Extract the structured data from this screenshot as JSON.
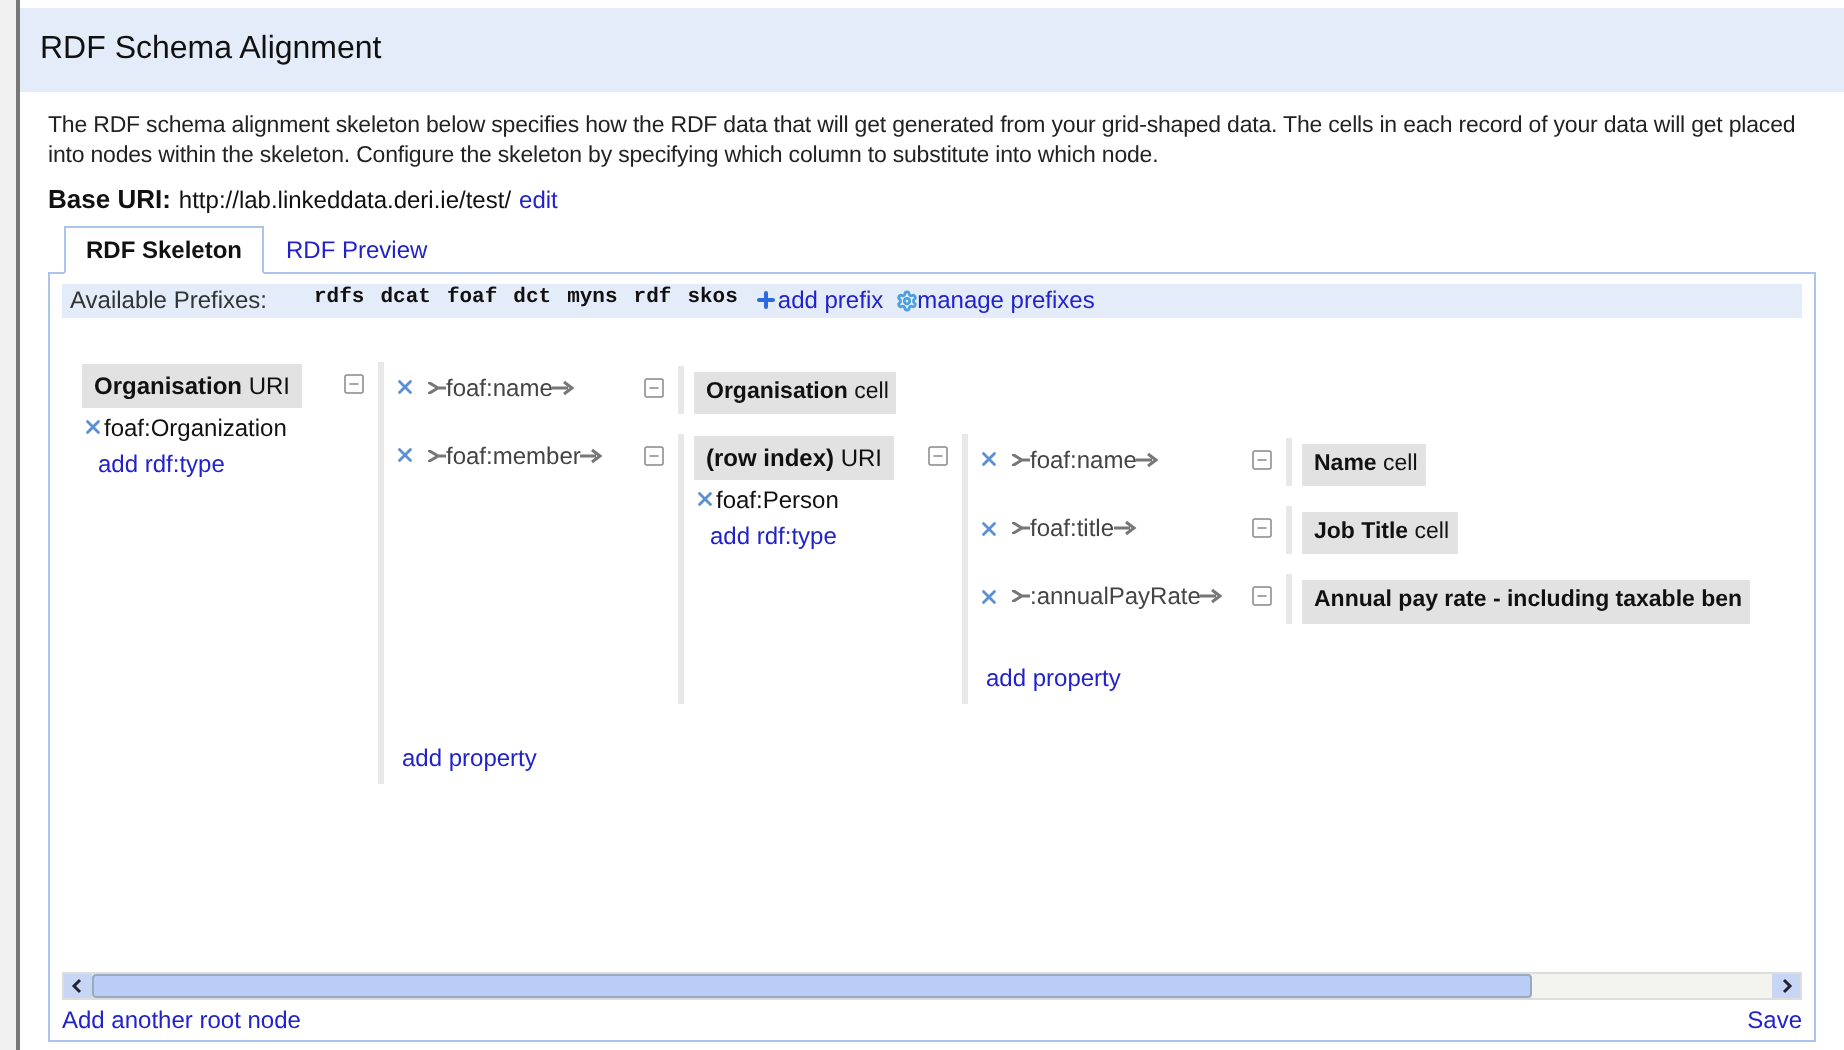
{
  "window": {
    "title": "RDF Schema Alignment"
  },
  "intro": "The RDF schema alignment skeleton below specifies how the RDF data that will get generated from your grid-shaped data. The cells in each record of your data will get placed into nodes within the skeleton. Configure the skeleton by specifying which column to substitute into which node.",
  "base_uri": {
    "label": "Base URI:",
    "value": "http://lab.linkeddata.deri.ie/test/",
    "edit": "edit"
  },
  "tabs": [
    {
      "label": "RDF Skeleton",
      "selected": true
    },
    {
      "label": "RDF Preview",
      "selected": false
    }
  ],
  "prefixes": {
    "label": "Available Prefixes:",
    "items": [
      "rdfs",
      "dcat",
      "foaf",
      "dct",
      "myns",
      "rdf",
      "skos"
    ],
    "add": "add prefix",
    "manage": "manage prefixes"
  },
  "skeleton": {
    "label": "**Organisation** URI",
    "kind": "uri",
    "types": [
      "foaf:Organization"
    ],
    "add_type": "add rdf:type",
    "add_property": "add property",
    "properties": [
      {
        "name": "foaf:name",
        "object": {
          "label": "**Organisation** cell",
          "kind": "cell"
        }
      },
      {
        "name": "foaf:member",
        "object": {
          "label": "**(row index)** URI",
          "kind": "uri",
          "types": [
            "foaf:Person"
          ],
          "add_type": "add rdf:type",
          "add_property": "add property",
          "properties": [
            {
              "name": "foaf:name",
              "object": {
                "label": "**Name** cell",
                "kind": "cell"
              }
            },
            {
              "name": "foaf:title",
              "object": {
                "label": "**Job Title** cell",
                "kind": "cell"
              }
            },
            {
              "name": ":annualPayRate",
              "object": {
                "label": "**Annual pay rate - including taxable ben**",
                "kind": "cell"
              }
            }
          ]
        }
      }
    ]
  },
  "footer": {
    "add_root": "Add another root node",
    "save": "Save"
  }
}
